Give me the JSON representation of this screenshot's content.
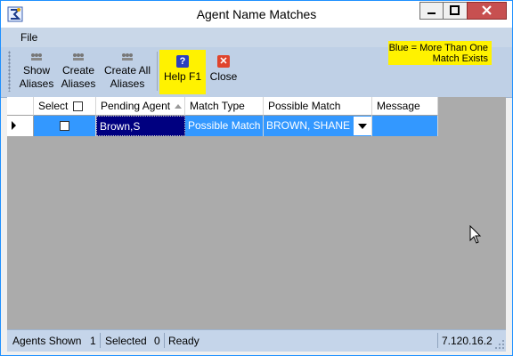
{
  "window": {
    "title": "Agent Name Matches",
    "accent": "#1e90ff"
  },
  "menu": {
    "file": "File"
  },
  "toolbar": {
    "show_aliases": [
      "Show",
      "Aliases"
    ],
    "create_aliases": [
      "Create",
      "Aliases"
    ],
    "create_all_aliases": [
      "Create All",
      "Aliases"
    ],
    "help": "Help F1",
    "close": "Close"
  },
  "legend": [
    "Blue = More Than One",
    "Match Exists"
  ],
  "grid": {
    "columns": [
      "Select",
      "Pending Agent",
      "Match Type",
      "Possible Match",
      "Message"
    ],
    "rows": [
      {
        "select": false,
        "pending_agent": "Brown,S",
        "match_type": "Possible Match",
        "possible_match": "BROWN, SHANE",
        "message": ""
      }
    ]
  },
  "status": {
    "agents_shown_label": "Agents Shown",
    "agents_shown": "1",
    "selected_label": "Selected",
    "selected": "0",
    "state": "Ready",
    "version": "7.120.16.2"
  }
}
